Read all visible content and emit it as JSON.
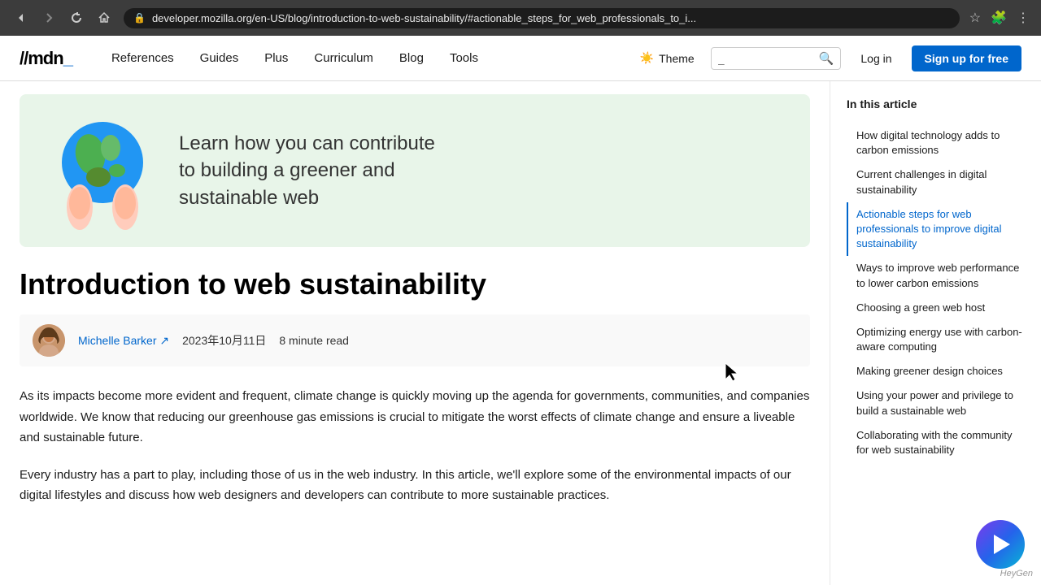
{
  "browser": {
    "url": "developer.mozilla.org/en-US/blog/introduction-to-web-sustainability/#actionable_steps_for_web_professionals_to_i...",
    "back_label": "←",
    "forward_label": "→",
    "refresh_label": "↻",
    "home_label": "⌂"
  },
  "nav": {
    "logo": "mdn",
    "links": [
      {
        "label": "References",
        "id": "references"
      },
      {
        "label": "Guides",
        "id": "guides"
      },
      {
        "label": "Plus",
        "id": "plus"
      },
      {
        "label": "Curriculum",
        "id": "curriculum"
      },
      {
        "label": "Blog",
        "id": "blog"
      },
      {
        "label": "Tools",
        "id": "tools"
      }
    ],
    "theme_label": "Theme",
    "search_placeholder": "_",
    "login_label": "Log in",
    "signup_label": "Sign up for free"
  },
  "hero": {
    "text_line1": "Learn how you can contribute",
    "text_line2": "to building a greener and",
    "text_line3": "sustainable web"
  },
  "article": {
    "title": "Introduction to web sustainability",
    "author_name": "Michelle Barker",
    "author_link": "Michelle Barker ↗",
    "date": "2023年10月11日",
    "read_time": "8 minute read",
    "paragraph1": "As its impacts become more evident and frequent, climate change is quickly moving up the agenda for governments, communities, and companies worldwide. We know that reducing our greenhouse gas emissions is crucial to mitigate the worst effects of climate change and ensure a liveable and sustainable future.",
    "paragraph2": "Every industry has a part to play, including those of us in the web industry. In this article, we'll explore some of the environmental impacts of our digital lifestyles and discuss how web designers and developers can contribute to more sustainable practices."
  },
  "sidebar": {
    "title": "In this article",
    "items": [
      {
        "label": "How digital technology adds to carbon emissions",
        "id": "toc-1"
      },
      {
        "label": "Current challenges in digital sustainability",
        "id": "toc-2"
      },
      {
        "label": "Actionable steps for web professionals to improve digital sustainability",
        "id": "toc-3"
      },
      {
        "label": "Ways to improve web performance to lower carbon emissions",
        "id": "toc-4"
      },
      {
        "label": "Choosing a green web host",
        "id": "toc-5"
      },
      {
        "label": "Optimizing energy use with carbon-aware computing",
        "id": "toc-6"
      },
      {
        "label": "Making greener design choices",
        "id": "toc-7"
      },
      {
        "label": "Using your power and privilege to build a sustainable web",
        "id": "toc-8"
      },
      {
        "label": "Collaborating with the community for web sustainability",
        "id": "toc-9"
      }
    ]
  }
}
